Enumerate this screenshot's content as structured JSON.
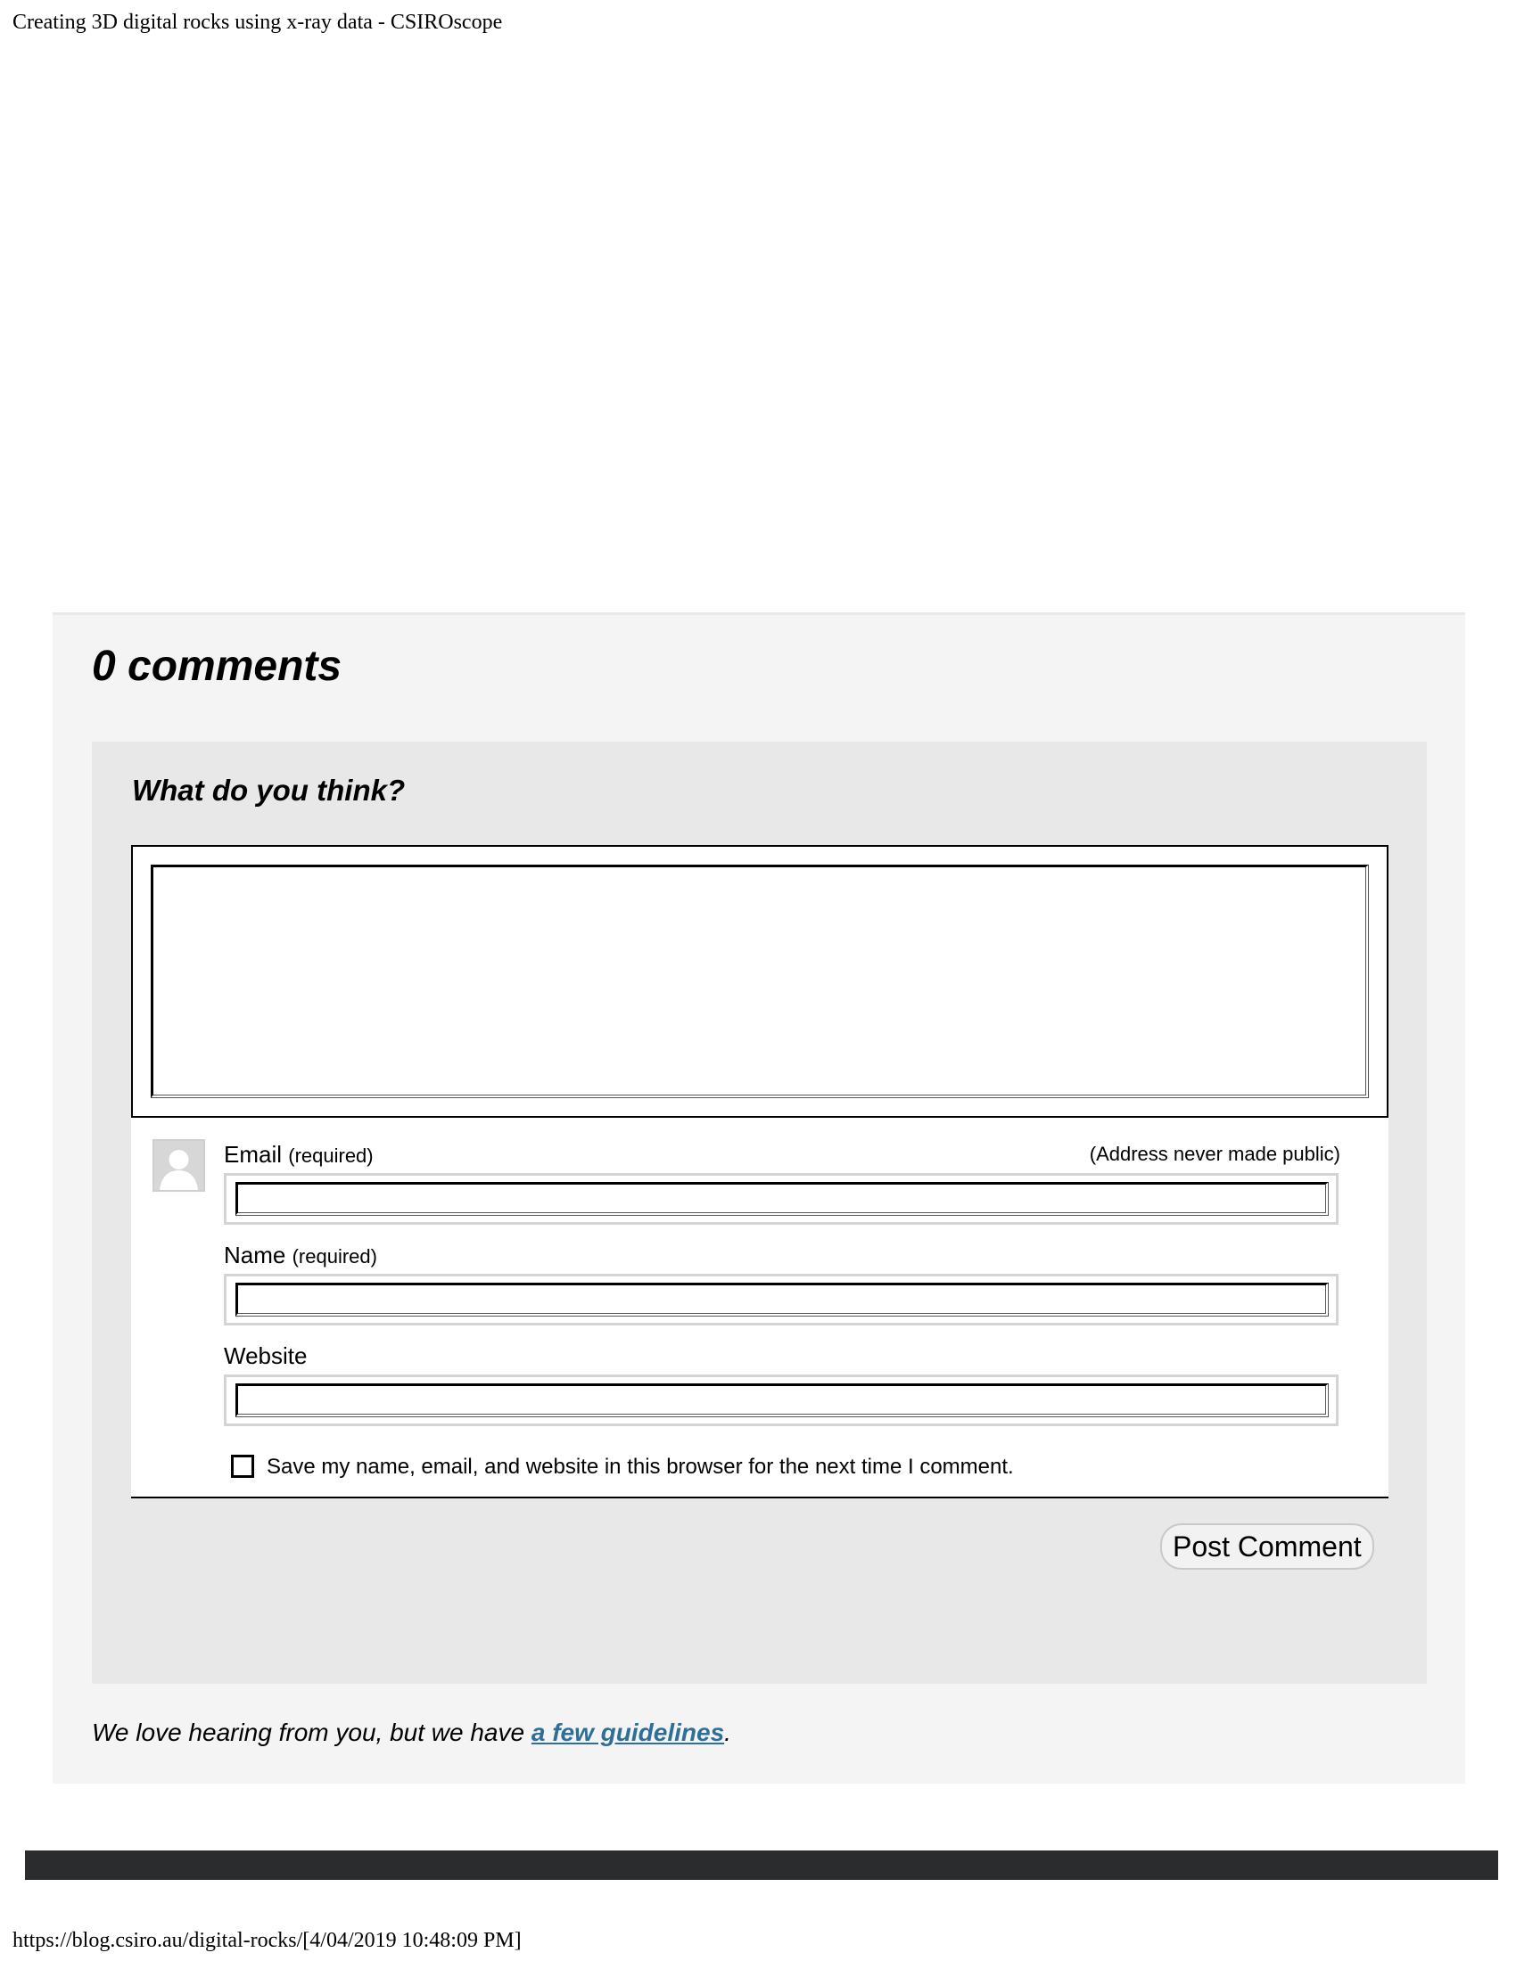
{
  "print_header": {
    "title": "Creating 3D digital rocks using x-ray data - CSIROscope"
  },
  "comments": {
    "count_title": "0 comments",
    "respond_title": "What do you think?",
    "email_label": "Email",
    "email_required": "(required)",
    "address_note": "(Address never made public)",
    "name_label": "Name",
    "name_required": "(required)",
    "website_label": "Website",
    "save_label": "Save my name, email, and website in this browser for the next time I comment.",
    "post_button_label": "Post Comment",
    "guidelines_prefix": "We love hearing from you, but we have ",
    "guidelines_link": "a few guidelines",
    "guidelines_suffix": "."
  },
  "print_footer": {
    "url_timestamp": "https://blog.csiro.au/digital-rocks/[4/04/2019 10:48:09 PM]"
  },
  "colors": {
    "section_bg": "#f4f4f4",
    "respond_bg": "#e7e8e7",
    "link": "#2e6f97",
    "footer_bar": "#2a2c2e"
  },
  "icons": {
    "avatar": "default-user-avatar-icon"
  }
}
